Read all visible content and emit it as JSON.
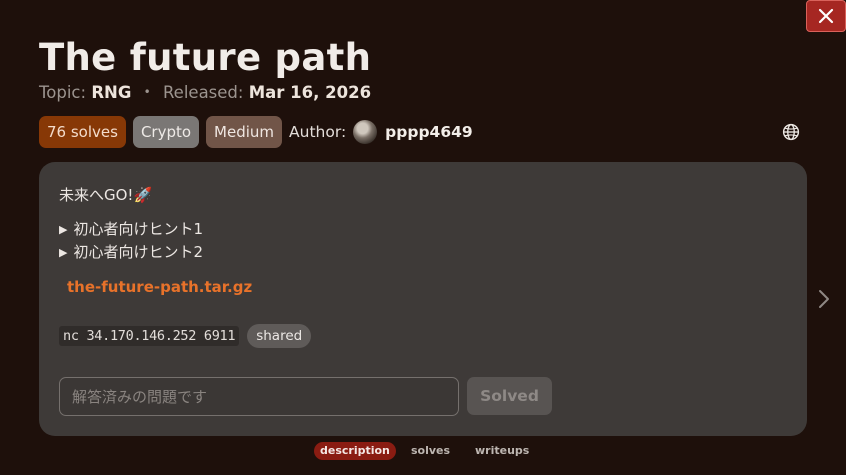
{
  "close_button": {
    "glyph": "✕"
  },
  "challenge": {
    "title": "The future path",
    "topic_label": "Topic:",
    "topic": "RNG",
    "separator": "•",
    "released_label": "Released:",
    "released": "Mar 16, 2026"
  },
  "tags": {
    "solves": "76 solves",
    "category": "Crypto",
    "difficulty": "Medium",
    "author_label": "Author:",
    "author_name": "pppp4649"
  },
  "description": {
    "text": "未来へGO!🚀",
    "hints": [
      {
        "label": "初心者向けヒント1"
      },
      {
        "label": "初心者向けヒント2"
      }
    ],
    "attachment": "the-future-path.tar.gz",
    "connection": "nc 34.170.146.252 6911",
    "connection_badge": "shared"
  },
  "flag_form": {
    "placeholder": "解答済みの問題です",
    "submit_label": "Solved"
  },
  "bottom_tabs": [
    {
      "label": "description",
      "active": true
    },
    {
      "label": "solves",
      "active": false
    },
    {
      "label": "writeups",
      "active": false
    }
  ],
  "colors": {
    "background": "#1e100b",
    "card": "#3e3a38",
    "accent_link": "#e8722a",
    "close_button": "#a62722",
    "active_tab": "#8a1c12"
  },
  "icons": [
    "close-icon",
    "globe-icon",
    "chevron-right-icon",
    "triangle-right-icon"
  ]
}
